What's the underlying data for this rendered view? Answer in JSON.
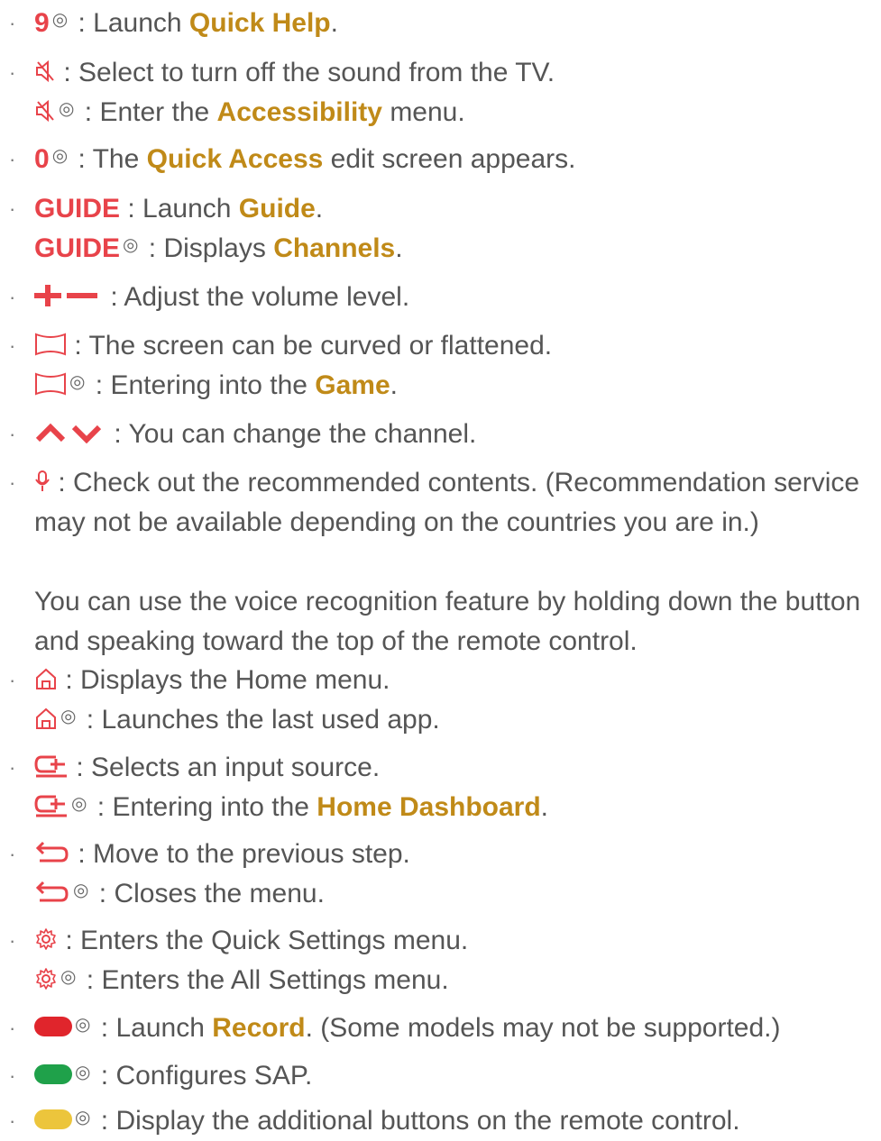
{
  "hold_mark": "◎",
  "colors": {
    "red": "#e8434a",
    "gold": "#c08a18",
    "text": "#555555",
    "record": "#e0252c",
    "sap": "#1fa14a",
    "yellow": "#ecc53c"
  },
  "items": {
    "nine": {
      "key": "9",
      "sep": " : Launch ",
      "target": "Quick Help",
      "end": "."
    },
    "mute": {
      "l1": " : Select to turn off the sound from the TV.",
      "l2_pre": " : Enter the ",
      "l2_target": "Accessibility",
      "l2_end": " menu."
    },
    "zero": {
      "key": "0",
      "sep": " : The ",
      "target": "Quick Access",
      "end": " edit screen appears."
    },
    "guide": {
      "key": "GUIDE",
      "l1_pre": " : Launch ",
      "l1_target": "Guide",
      "l1_end": ".",
      "l2_pre": " : Displays ",
      "l2_target": "Channels",
      "l2_end": "."
    },
    "volume": {
      "text": " : Adjust the volume level."
    },
    "curve": {
      "l1": " : The screen can be curved or flattened.",
      "l2_pre": " : Entering into the ",
      "l2_target": "Game",
      "l2_end": "."
    },
    "channel": {
      "text": " : You can change the channel."
    },
    "mic": {
      "l1": " : Check out the recommended contents. (Recommendation service may not be available depending on the countries you are in.)",
      "l2": "You can use the voice recognition feature by holding down the button and speaking toward the top of the remote control."
    },
    "home": {
      "l1": " : Displays the Home menu.",
      "l2": " : Launches the last used app."
    },
    "input": {
      "l1": " : Selects an input source.",
      "l2_pre": " : Entering into the ",
      "l2_target": "Home Dashboard",
      "l2_end": "."
    },
    "back": {
      "l1": " : Move to the previous step.",
      "l2": " : Closes the menu."
    },
    "settings": {
      "l1": " : Enters the Quick Settings menu.",
      "l2": " : Enters the All Settings menu."
    },
    "record": {
      "pre": " : Launch ",
      "target": "Record",
      "end": ". (Some models may not be supported.)"
    },
    "sap": {
      "text": " : Configures SAP."
    },
    "yellow": {
      "text": " : Display the additional buttons on the remote control."
    }
  }
}
